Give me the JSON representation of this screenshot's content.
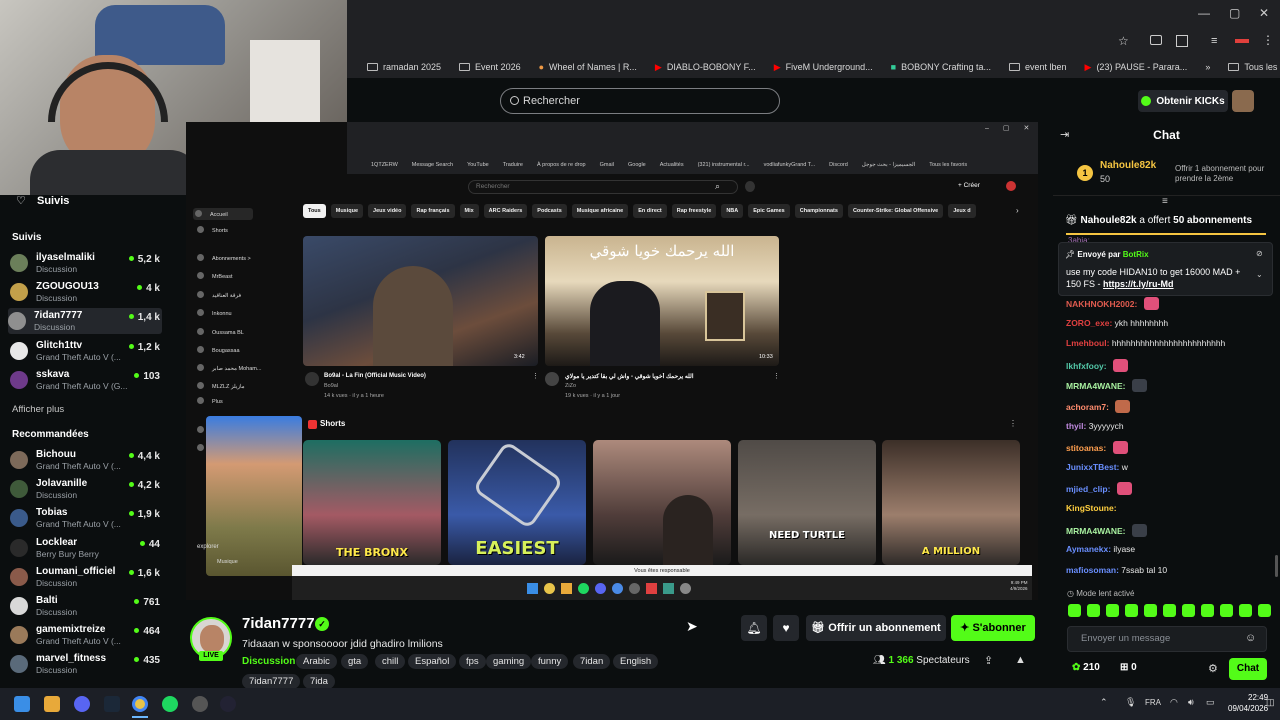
{
  "browser": {
    "bookmarks": [
      "ramadan 2025",
      "Event 2026",
      "Wheel of Names | R...",
      "DIABLO-BOBONY F...",
      "FiveM Underground...",
      "BOBONY Crafting ta...",
      "event lben",
      "(23) PAUSE - Parara..."
    ],
    "all_bookmarks": "Tous les favoris"
  },
  "kick": {
    "search_placeholder": "Rechercher",
    "kicks_button": "Obtenir KICKs"
  },
  "sidebar": {
    "following_header": "Suivis",
    "followed_section": "Suivis",
    "followed": [
      {
        "name": "ilyaselmaliki",
        "sub": "Discussion",
        "count": "5,2 k",
        "color": "#6b7f5a"
      },
      {
        "name": "ZGOUGOU13",
        "sub": "Discussion",
        "count": "4 k",
        "color": "#c2a04a"
      },
      {
        "name": "7idan7777",
        "sub": "Discussion",
        "count": "1,4 k",
        "color": "#8f8f8f"
      },
      {
        "name": "Glitch1ttv",
        "sub": "Grand Theft Auto V (...",
        "count": "1,2 k",
        "color": "#e8e8e8"
      },
      {
        "name": "sskava",
        "sub": "Grand Theft Auto V (G...",
        "count": "103",
        "color": "#6e3a8a"
      }
    ],
    "show_more": "Afficher plus",
    "recommended_section": "Recommandées",
    "recommended": [
      {
        "name": "Bichouu",
        "sub": "Grand Theft Auto V (...",
        "count": "4,4 k",
        "color": "#7d6a5a"
      },
      {
        "name": "Jolavanille",
        "sub": "Discussion",
        "count": "4,2 k",
        "color": "#3f5a3a"
      },
      {
        "name": "Tobias",
        "sub": "Grand Theft Auto V (...",
        "count": "1,9 k",
        "color": "#3a5a8a"
      },
      {
        "name": "Locklear",
        "sub": "Berry Bury Berry",
        "count": "44",
        "color": "#2a2a2a"
      },
      {
        "name": "Loumani_officiel",
        "sub": "Discussion",
        "count": "1,6 k",
        "color": "#8a5a4a"
      },
      {
        "name": "Balti",
        "sub": "Discussion",
        "count": "761",
        "color": "#d8d8d8"
      },
      {
        "name": "gamemixtreize",
        "sub": "Grand Theft Auto V (...",
        "count": "464",
        "color": "#9a7a5a"
      },
      {
        "name": "marvel_fitness",
        "sub": "Discussion",
        "count": "435",
        "color": "#5a6a7a"
      }
    ]
  },
  "stream": {
    "yt": {
      "search_placeholder": "Rechercher",
      "create": "+ Créer",
      "bookmarks": [
        "1QTZERW",
        "Message Search",
        "YouTube",
        "Traduire",
        "À propos de re drop",
        "Gmail",
        "Google",
        "Actualités",
        "(321) instrumental r...",
        "vodliafunkyGrand T...",
        "Discord",
        "الجسيميزا - بحث جوجل",
        "Tous les favoris"
      ],
      "side": [
        "Accueil",
        "Shorts",
        "Abonnements >",
        "MrBeast",
        "فرقة العناقيد",
        "Inkonnu",
        "Oussama BL",
        "Bougassaa",
        "محمد صابر Moham...",
        "MLZLZ مازيلز",
        "Plus",
        "Vous >",
        "Hist"
      ],
      "chips": [
        "Tous",
        "Musique",
        "Jeux vidéo",
        "Rap français",
        "Mix",
        "ARC Raiders",
        "Podcasts",
        "Musique africaine",
        "En direct",
        "Rap freestyle",
        "NBA",
        "Epic Games",
        "Championnats",
        "Counter-Strike: Global Offensive",
        "Jeux d"
      ],
      "video1": {
        "title": "Bo9al - La Fin (Official Music Video)",
        "channel": "Bo9al",
        "meta": "14 k vues · il y a 1 heure",
        "duration": "3:42"
      },
      "video2": {
        "title": "الله يرحمك أخويا شوقي - واش لي بقا كتدير يا مولاي",
        "channel": "ZiZo",
        "meta": "19 k vues · il y a 1 jour",
        "duration": "10:33",
        "overlay": "الله يرحمك خويا شوقي"
      },
      "shorts_label": "Shorts",
      "shorts": [
        "THE BRONX",
        "EASIEST",
        "",
        "NEED TURTLE",
        "A MILLION"
      ],
      "explorer": "explorer",
      "music": "Musique",
      "tooltip": "Vous êtes responsable",
      "clock": "9:49 PM\n4/9/2026"
    }
  },
  "streamer": {
    "name": "7idan7777",
    "live": "LIVE",
    "title": "7idaaan w sponsoooor jdid ghadiro lmilions",
    "category": "Discussion",
    "tags": [
      "Arabic",
      "gta",
      "chill",
      "Español",
      "fps",
      "gaming",
      "funny",
      "7idan",
      "English",
      "7idan7777",
      "7ida"
    ],
    "gift_button": "Offrir un abonnement",
    "subscribe_button": "S'abonner",
    "viewers": "1 366",
    "viewers_label": "Spectateurs"
  },
  "chat": {
    "title": "Chat",
    "pinned_user": "Nahoule82k",
    "pinned_amount": "50",
    "pinned_text": "Offrir 1 abonnement pour prendre la 2ème",
    "gift_user": "Nahoule82k",
    "gift_text": "a offert",
    "gift_count": "50",
    "gift_suffix": "abonnements",
    "partial_name": "3abia:",
    "botrix_sent": "Envoyé par",
    "botrix_name": "BotRix",
    "botrix_msg": "use my code HIDAN10 to get 16000 MAD + 150 FS -",
    "botrix_link": "https://t.ly/ru-Md",
    "messages": [
      {
        "user": "NAKHNOKH2002:",
        "text": "",
        "color": "#e05b4f"
      },
      {
        "user": "ZORO_exe:",
        "text": "ykh hhhhhhhh",
        "color": "#e04040"
      },
      {
        "user": "Lmehboul:",
        "text": "hhhhhhhhhhhhhhhhhhhhhhhh",
        "color": "#e04040"
      },
      {
        "user": "lkhfxfooy:",
        "text": "",
        "color": "#53c8a8"
      },
      {
        "user": "MRMA4WANE:",
        "text": "",
        "color": "#a8f0a0"
      },
      {
        "user": "achoram7:",
        "text": "",
        "color": "#ff8c6e"
      },
      {
        "user": "thyil:",
        "text": "3yyyyych",
        "color": "#c08ae0"
      },
      {
        "user": "stitoanas:",
        "text": "",
        "color": "#ff9f4f"
      },
      {
        "user": "JunixxTBest:",
        "text": "w",
        "color": "#6a8fff"
      },
      {
        "user": "mjied_clip:",
        "text": "",
        "color": "#6a8fff"
      },
      {
        "user": "KingStoune:",
        "text": "",
        "color": "#ffcf40"
      },
      {
        "user": "MRMA4WANE:",
        "text": "",
        "color": "#a8f0a0"
      },
      {
        "user": "Aymanekx:",
        "text": "ilyase",
        "color": "#6a8fff"
      },
      {
        "user": "mafiosoman:",
        "text": "7ssab tal 10",
        "color": "#6a8fff"
      }
    ],
    "slow_mode": "Mode lent activé",
    "input_placeholder": "Envoyer un message",
    "points": "210",
    "items": "0",
    "send": "Chat"
  },
  "taskbar": {
    "lang": "FRA",
    "time": "22:49",
    "date": "09/04/2026"
  },
  "colors": {
    "accent": "#53fc18",
    "bg": "#0b0e0f",
    "panel": "#24272c"
  }
}
